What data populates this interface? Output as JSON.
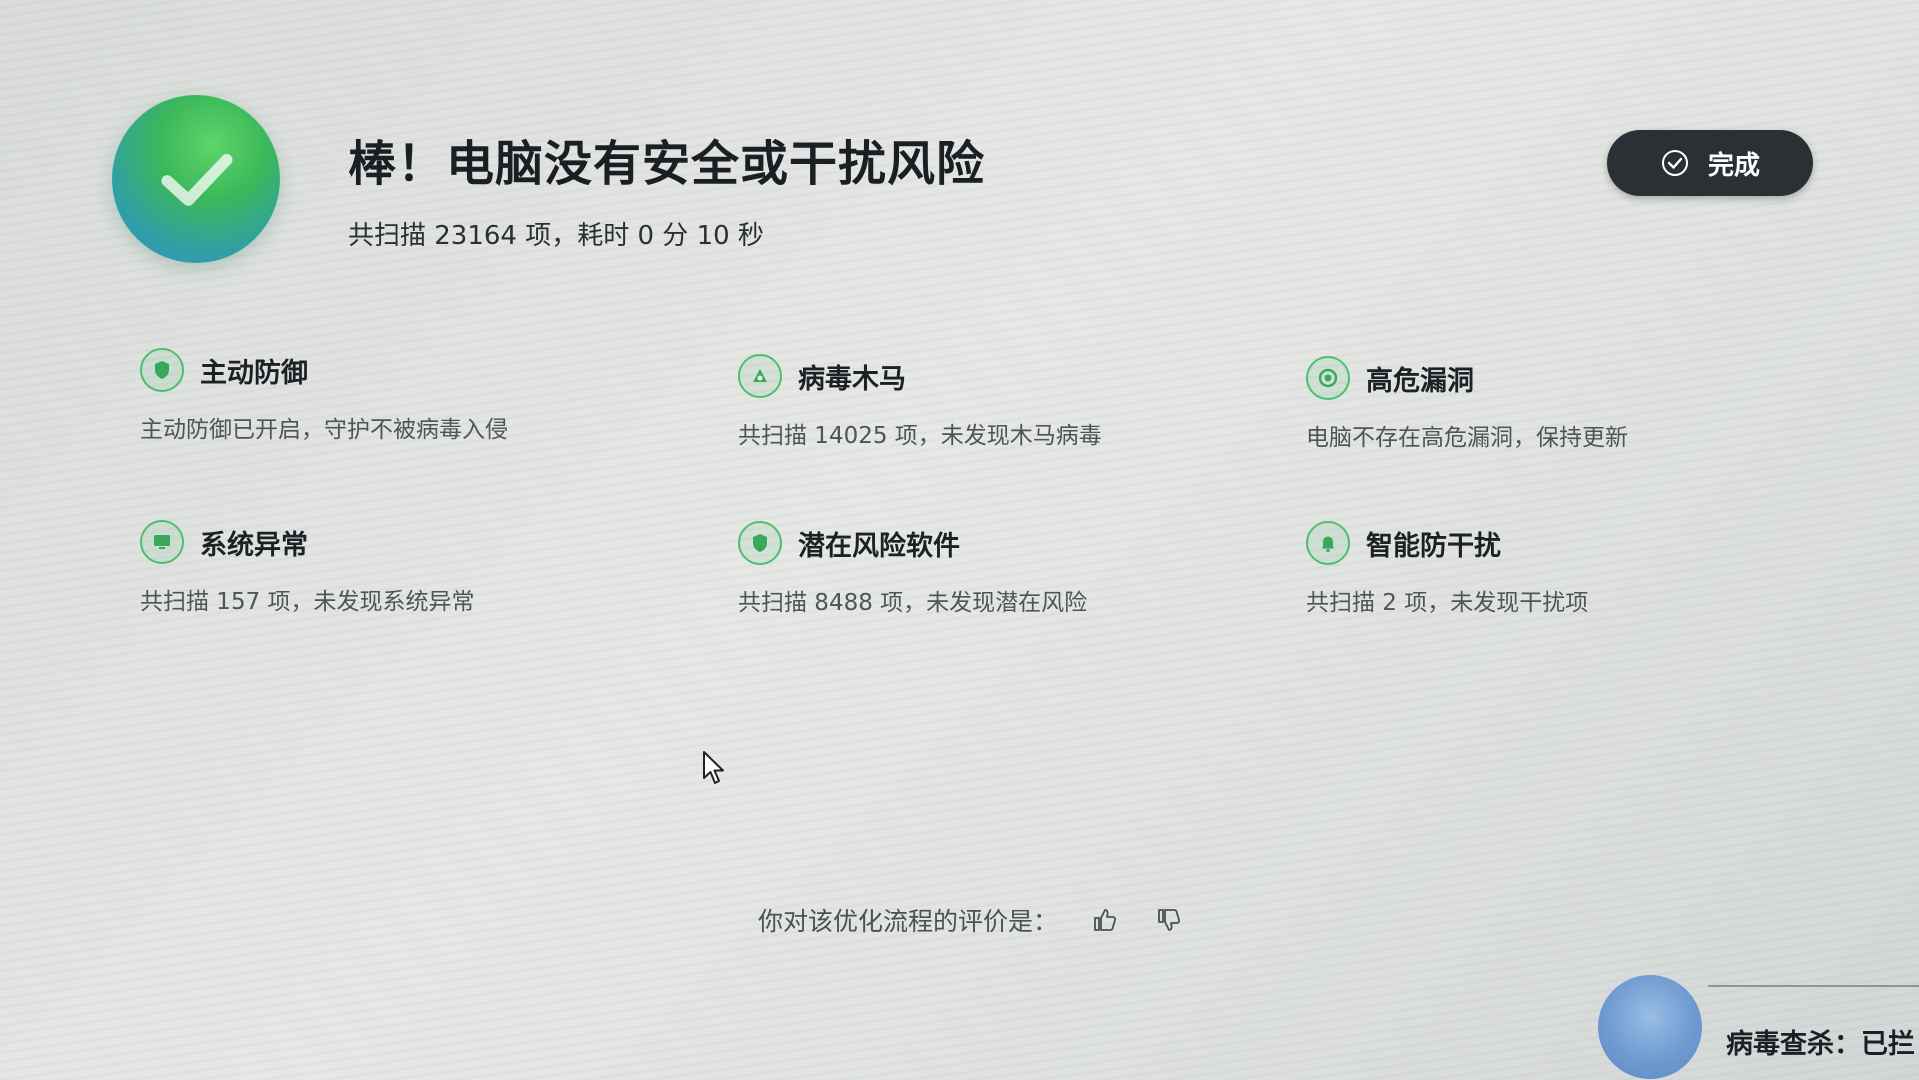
{
  "header": {
    "title": "棒！电脑没有安全或干扰风险",
    "summary": "共扫描 23164 项，耗时 0 分 10 秒",
    "done_label": "完成"
  },
  "results": [
    {
      "title": "主动防御",
      "desc": "主动防御已开启，守护不被病毒入侵",
      "icon": "shield-icon"
    },
    {
      "title": "病毒木马",
      "desc": "共扫描 14025 项，未发现木马病毒",
      "icon": "virus-icon"
    },
    {
      "title": "高危漏洞",
      "desc": "电脑不存在高危漏洞，保持更新",
      "icon": "target-icon"
    },
    {
      "title": "系统异常",
      "desc": "共扫描 157 项，未发现系统异常",
      "icon": "monitor-icon"
    },
    {
      "title": "潜在风险软件",
      "desc": "共扫描 8488 项，未发现潜在风险",
      "icon": "shield-icon"
    },
    {
      "title": "智能防干扰",
      "desc": "共扫描 2 项，未发现干扰项",
      "icon": "bell-icon"
    }
  ],
  "feedback": {
    "prompt": "你对该优化流程的评价是："
  },
  "footer": {
    "status_text": "病毒查杀：已拦"
  },
  "colors": {
    "accent_green": "#4bbf6c",
    "button_dark": "#2a3034"
  }
}
